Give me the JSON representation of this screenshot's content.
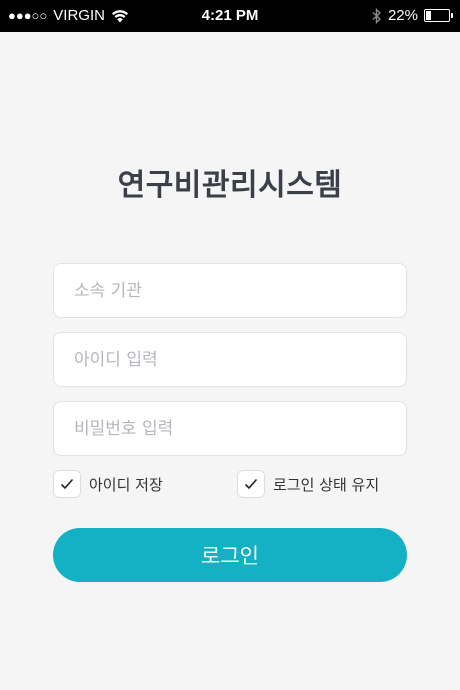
{
  "status_bar": {
    "carrier": "VIRGIN",
    "signal_dots": "●●●○○",
    "time": "4:21 PM",
    "battery_percent": "22%",
    "battery_level": 0.22
  },
  "app": {
    "title": "연구비관리시스템"
  },
  "form": {
    "institution_placeholder": "소속 기관",
    "id_placeholder": "아이디 입력",
    "password_placeholder": "비밀번호 입력",
    "save_id_label": "아이디 저장",
    "save_id_checked": true,
    "keep_login_label": "로그인 상태 유지",
    "keep_login_checked": true,
    "login_button": "로그인"
  },
  "colors": {
    "accent": "#13b1c3",
    "title": "#3b3f48",
    "background": "#f5f5f6"
  }
}
